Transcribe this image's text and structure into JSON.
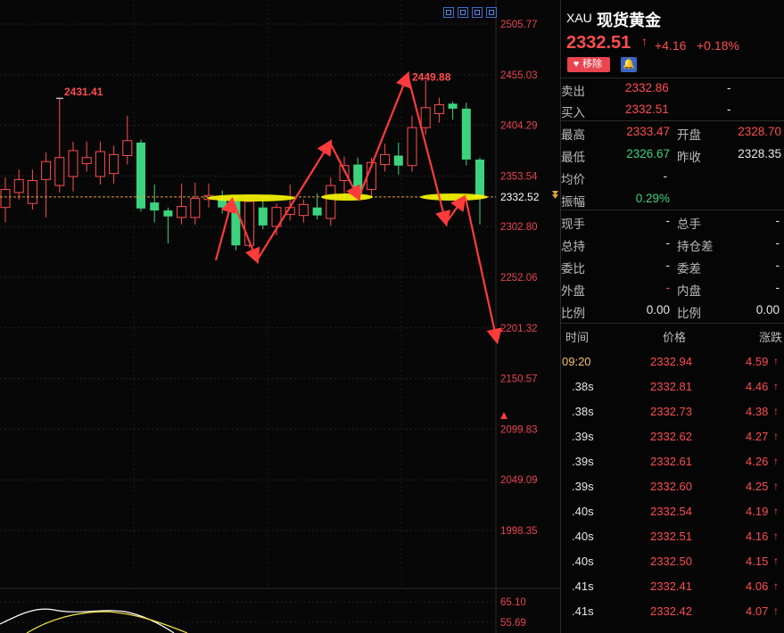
{
  "chart_data": {
    "type": "candlestick",
    "y_ticks": [
      "2505.77",
      "2455.03",
      "2404.29",
      "2353.54",
      "2302.80",
      "2252.06",
      "2201.32",
      "2150.57",
      "2099.83",
      "2049.09",
      "1998.35"
    ],
    "y_range": [
      1998.35,
      2505.77
    ],
    "current_price_label": "2332.52",
    "annotations": {
      "high_label": "2431.41",
      "peak_label": "2449.88"
    },
    "candles": [
      {
        "o": 2322,
        "c": 2340,
        "h": 2352,
        "l": 2307
      },
      {
        "o": 2337,
        "c": 2350,
        "h": 2360,
        "l": 2330
      },
      {
        "o": 2326,
        "c": 2349,
        "h": 2360,
        "l": 2320
      },
      {
        "o": 2350,
        "c": 2368,
        "h": 2377,
        "l": 2312
      },
      {
        "o": 2344,
        "c": 2372,
        "h": 2431.41,
        "l": 2337
      },
      {
        "o": 2353,
        "c": 2379,
        "h": 2388,
        "l": 2338
      },
      {
        "o": 2366,
        "c": 2372,
        "h": 2388,
        "l": 2358
      },
      {
        "o": 2353,
        "c": 2378,
        "h": 2388,
        "l": 2345
      },
      {
        "o": 2356,
        "c": 2375,
        "h": 2384,
        "l": 2346
      },
      {
        "o": 2374,
        "c": 2389,
        "h": 2414,
        "l": 2365
      },
      {
        "o": 2387,
        "c": 2321,
        "h": 2390,
        "l": 2318
      },
      {
        "o": 2327,
        "c": 2319,
        "h": 2345,
        "l": 2307
      },
      {
        "o": 2319,
        "c": 2313,
        "h": 2322,
        "l": 2286
      },
      {
        "o": 2312,
        "c": 2323,
        "h": 2346,
        "l": 2305
      },
      {
        "o": 2312,
        "c": 2331,
        "h": 2347,
        "l": 2305
      },
      {
        "o": 2330,
        "c": 2334,
        "h": 2346,
        "l": 2322
      },
      {
        "o": 2330,
        "c": 2322,
        "h": 2339,
        "l": 2316
      },
      {
        "o": 2328,
        "c": 2284,
        "h": 2334,
        "l": 2279
      },
      {
        "o": 2284,
        "c": 2328,
        "h": 2331,
        "l": 2282
      },
      {
        "o": 2322,
        "c": 2304,
        "h": 2332,
        "l": 2300
      },
      {
        "o": 2303,
        "c": 2322,
        "h": 2326,
        "l": 2294
      },
      {
        "o": 2315,
        "c": 2322,
        "h": 2345,
        "l": 2309
      },
      {
        "o": 2314,
        "c": 2325,
        "h": 2330,
        "l": 2307
      },
      {
        "o": 2322,
        "c": 2314,
        "h": 2336,
        "l": 2310
      },
      {
        "o": 2311,
        "c": 2344,
        "h": 2352,
        "l": 2304
      },
      {
        "o": 2349,
        "c": 2364,
        "h": 2373,
        "l": 2332
      },
      {
        "o": 2365,
        "c": 2336,
        "h": 2372,
        "l": 2331
      },
      {
        "o": 2340,
        "c": 2367,
        "h": 2372,
        "l": 2333
      },
      {
        "o": 2365,
        "c": 2375,
        "h": 2386,
        "l": 2358
      },
      {
        "o": 2374,
        "c": 2364,
        "h": 2387,
        "l": 2355
      },
      {
        "o": 2364,
        "c": 2402,
        "h": 2414,
        "l": 2358
      },
      {
        "o": 2402,
        "c": 2422,
        "h": 2449.88,
        "l": 2395
      },
      {
        "o": 2416,
        "c": 2425,
        "h": 2432,
        "l": 2407
      },
      {
        "o": 2426,
        "c": 2421,
        "h": 2428,
        "l": 2410
      },
      {
        "o": 2421,
        "c": 2370,
        "h": 2427,
        "l": 2364
      },
      {
        "o": 2370,
        "c": 2332,
        "h": 2372,
        "l": 2305
      }
    ],
    "indicator_ticks": [
      "65.10",
      "55.69"
    ]
  },
  "quote": {
    "code": "XAU",
    "name": "现货黄金",
    "price": "2332.51",
    "arrow": "↑",
    "change": "+4.16",
    "change_pct": "+0.18%",
    "fav_label": "移除",
    "rows1": [
      {
        "label": "卖出",
        "value": "2332.86",
        "extra": "-"
      },
      {
        "label": "买入",
        "value": "2332.51",
        "extra": "-"
      }
    ],
    "rows2": [
      {
        "l1": "最高",
        "v1": "2333.47",
        "l2": "开盘",
        "v2": "2328.70"
      },
      {
        "l1": "最低",
        "v1": "2326.67",
        "l2": "昨收",
        "v2": "2328.35"
      },
      {
        "l1": "均价",
        "v1": "-",
        "l2": "",
        "v2": ""
      },
      {
        "l1": "振幅",
        "v1": "0.29%",
        "l2": "",
        "v2": ""
      }
    ],
    "rows3": [
      {
        "l1": "现手",
        "v1": "-",
        "l2": "总手",
        "v2": "-"
      },
      {
        "l1": "总持",
        "v1": "-",
        "l2": "持仓差",
        "v2": "-"
      },
      {
        "l1": "委比",
        "v1": "-",
        "l2": "委差",
        "v2": "-"
      },
      {
        "l1": "外盘",
        "v1": "-",
        "l2": "内盘",
        "v2": "-"
      },
      {
        "l1": "比例",
        "v1": "0.00",
        "l2": "比例",
        "v2": "0.00"
      }
    ],
    "tick_header": {
      "time": "时间",
      "price": "价格",
      "chg": "涨跌"
    },
    "ticks": [
      {
        "t": "09:20",
        "p": "2332.94",
        "c": "4.59"
      },
      {
        "t": ".38s",
        "p": "2332.81",
        "c": "4.46"
      },
      {
        "t": ".38s",
        "p": "2332.73",
        "c": "4.38"
      },
      {
        "t": ".39s",
        "p": "2332.62",
        "c": "4.27"
      },
      {
        "t": ".39s",
        "p": "2332.61",
        "c": "4.26"
      },
      {
        "t": ".39s",
        "p": "2332.60",
        "c": "4.25"
      },
      {
        "t": ".40s",
        "p": "2332.54",
        "c": "4.19"
      },
      {
        "t": ".40s",
        "p": "2332.51",
        "c": "4.16"
      },
      {
        "t": ".40s",
        "p": "2332.50",
        "c": "4.15"
      },
      {
        "t": ".41s",
        "p": "2332.41",
        "c": "4.06"
      },
      {
        "t": ".41s",
        "p": "2332.42",
        "c": "4.07"
      }
    ],
    "arrow_up": "↑"
  }
}
